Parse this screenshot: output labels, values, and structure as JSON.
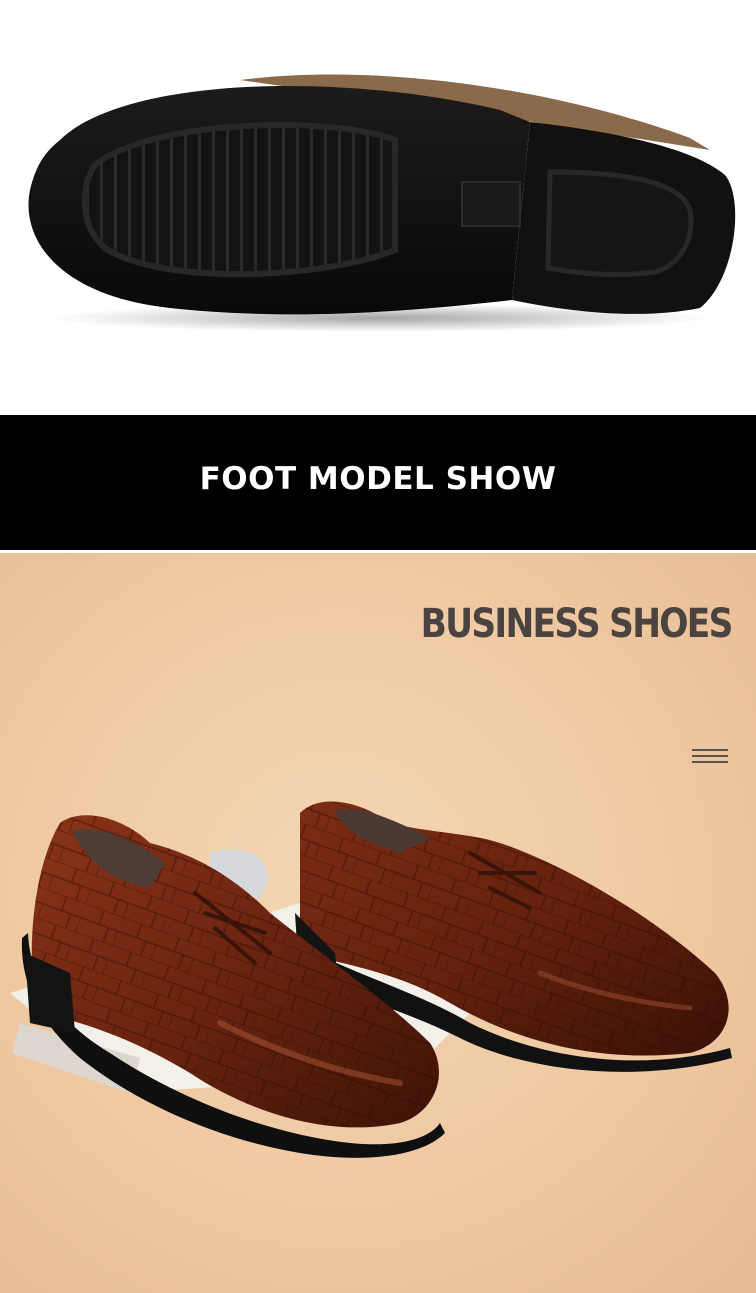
{
  "banner": {
    "title": "FOOT MODEL SHOW"
  },
  "model_section": {
    "headline": "BUSINESS SHOES",
    "menu_icon": "menu-lines-icon"
  },
  "colors": {
    "banner_background": "#000000",
    "banner_text": "#ffffff",
    "backdrop": "#efc9a2",
    "headline_text": "#4a4340",
    "leather": "#6b2410",
    "sole": "#111111"
  }
}
